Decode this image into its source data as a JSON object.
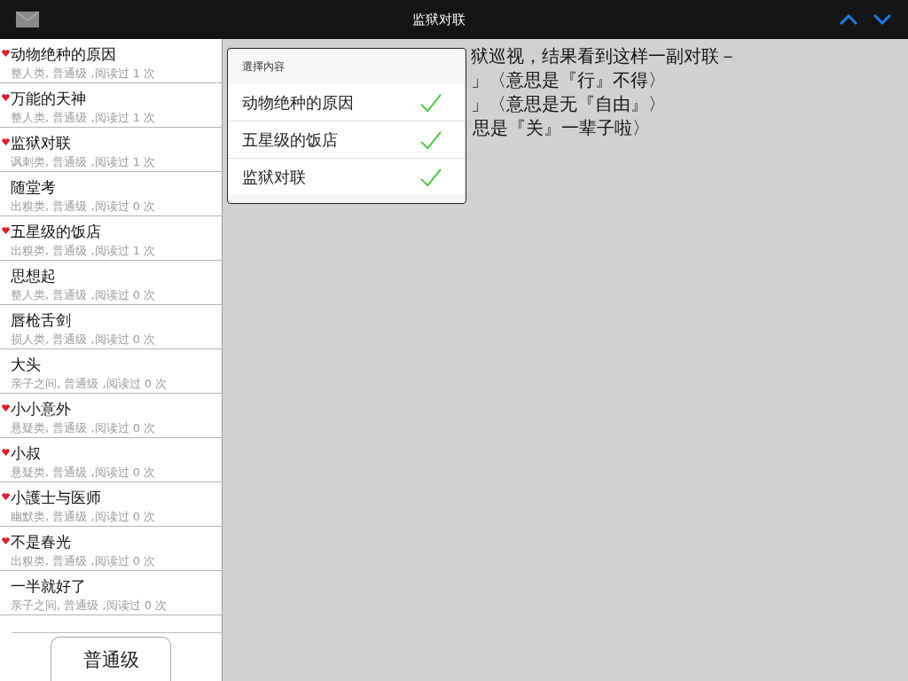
{
  "nav_bar": {
    "title": "监狱对联"
  },
  "sidebar": {
    "items": [
      {
        "title": "动物绝种的原因",
        "detail": "整人类, 普通级 ,阅读过 1 次",
        "favorite": true
      },
      {
        "title": "万能的天神",
        "detail": "整人类, 普通级 ,阅读过 1 次",
        "favorite": true
      },
      {
        "title": "监狱对联",
        "detail": "讽刺类, 普通级 ,阅读过 1 次",
        "favorite": true
      },
      {
        "title": "随堂考",
        "detail": "出糗类, 普通级 ,阅读过 0 次",
        "favorite": false
      },
      {
        "title": "五星级的饭店",
        "detail": "出糗类, 普通级 ,阅读过 1 次",
        "favorite": true
      },
      {
        "title": "思想起",
        "detail": "整人类, 普通级 ,阅读过 0 次",
        "favorite": false
      },
      {
        "title": "唇枪舌剑",
        "detail": "损人类, 普通级 ,阅读过 0 次",
        "favorite": false
      },
      {
        "title": "大头",
        "detail": "亲子之间, 普通级 ,阅读过 0 次",
        "favorite": false
      },
      {
        "title": "小小意外",
        "detail": "悬疑类, 普通级 ,阅读过 0 次",
        "favorite": true
      },
      {
        "title": "小叔",
        "detail": "悬疑类, 普通级 ,阅读过 0 次",
        "favorite": true
      },
      {
        "title": "小護士与医师",
        "detail": "幽默类, 普通级 ,阅读过 0 次",
        "favorite": true
      },
      {
        "title": "不是春光",
        "detail": "出糗类, 普通级 ,阅读过 0 次",
        "favorite": true
      },
      {
        "title": "一半就好了",
        "detail": "亲子之间, 普通级 ,阅读过 0 次",
        "favorite": false
      }
    ],
    "segment": {
      "label": "普通级"
    }
  },
  "content": {
    "lines": [
      "狱巡视，结果看到这样一副对联－",
      "」〈意思是『行』不得〉",
      "」〈意思是无『自由』〉",
      "思是『关』一辈子啦〉"
    ]
  },
  "popover": {
    "title": "選擇內容",
    "items": [
      {
        "label": "动物绝种的原因",
        "checked": true
      },
      {
        "label": "五星级的饭店",
        "checked": true
      },
      {
        "label": "监狱对联",
        "checked": true
      }
    ]
  }
}
